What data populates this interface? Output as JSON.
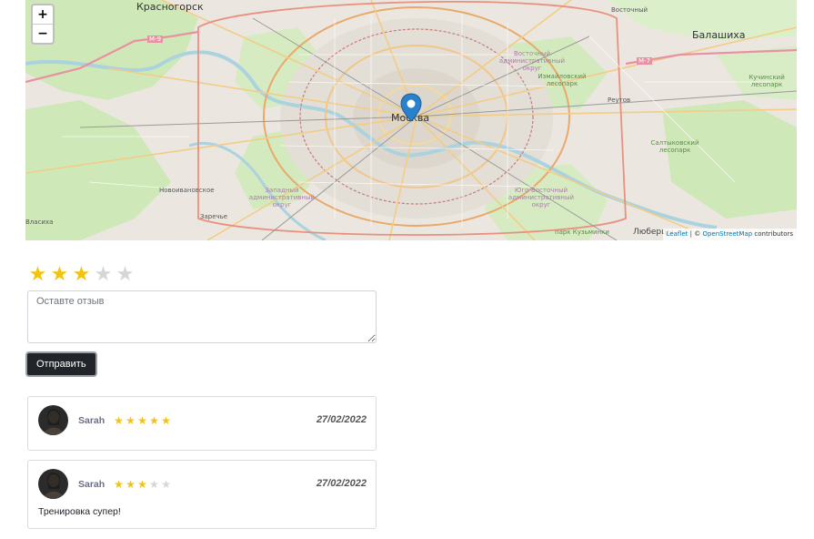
{
  "map": {
    "zoom_in": "+",
    "zoom_out": "−",
    "center_label": "Москва",
    "labels": {
      "krasnogorsk": "Красногорск",
      "balashikha": "Балашиха",
      "reutov": "Реутов",
      "novoivankovskoe": "Новоивановское",
      "zarechye": "Заречье",
      "lyubertsy": "Люберцы",
      "vostochny": "Восточный",
      "kuchino": "Кучинский лесопарк",
      "saltykovsky": "Салтыковский лесопарк",
      "vlasikha": "Власиха",
      "m9": "М-9",
      "m7": "М-7",
      "d_east": "Восточный административный округ",
      "d_west": "Западный административный округ",
      "d_southeast": "Юго-Восточный административный округ",
      "izmailovsky": "Измайловский лесопарк",
      "kuzminki": "парк Кузьминки"
    },
    "attribution": {
      "leaflet": "Leaflet",
      "separator": " | © ",
      "osm": "OpenStreetMap",
      "suffix": " contributors"
    }
  },
  "rating_form": {
    "value": 3,
    "max": 5,
    "placeholder": "Оставте отзыв",
    "submit_label": "Отправить"
  },
  "colors": {
    "star_on": "#f2c311",
    "star_off": "#d6d6d6"
  },
  "reviews": [
    {
      "author": "Sarah",
      "rating": 5,
      "date": "27/02/2022",
      "text": ""
    },
    {
      "author": "Sarah",
      "rating": 3,
      "date": "27/02/2022",
      "text": "Тренировка супер!"
    }
  ]
}
